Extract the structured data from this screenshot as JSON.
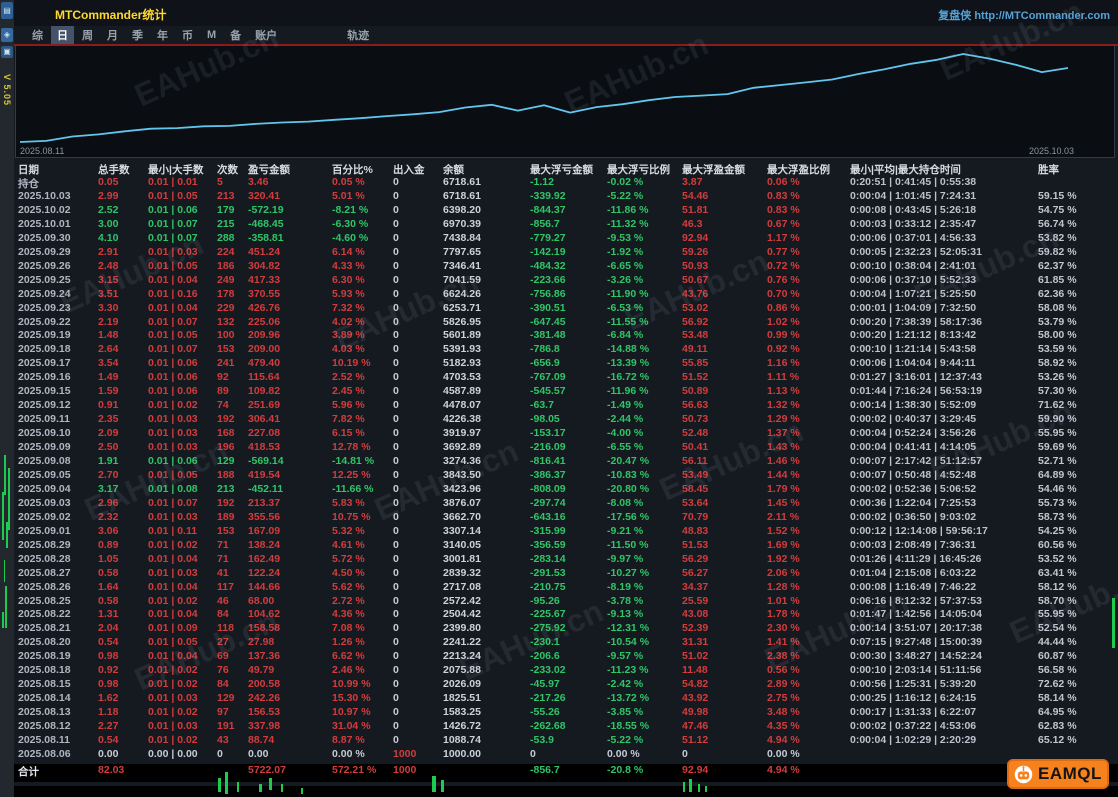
{
  "window": {
    "title": "MTCommander统计",
    "site_link": "复盘侠 http://MTCommander.com",
    "version": "V 5.05"
  },
  "tabs": {
    "items": [
      "综",
      "日",
      "周",
      "月",
      "季",
      "年",
      "币",
      "M",
      "备",
      "账户"
    ],
    "active": "日",
    "detached": "轨迹"
  },
  "watermark": "EAHub.cn",
  "logo": {
    "text": "EAMQL",
    "icon": "robot-icon"
  },
  "colors": {
    "profit_red": "#d23c3c",
    "loss_green": "#2fc566",
    "neutral": "#c6ccd5",
    "date_text": "#aeb6c2",
    "time_text": "#bac2cc",
    "curve_blue": "#62c6ec",
    "title_yellow": "#ffd92e",
    "link_blue": "#53a3d8",
    "logo_orange": "#f6821f"
  },
  "chart": {
    "start_label": "2025.08.11",
    "end_label": "2025.10.03"
  },
  "chart_data": {
    "type": "line",
    "title": "账户余额曲线",
    "xlabel": "",
    "ylabel": "余额",
    "ylim": [
      1000,
      7797.65
    ],
    "legend": "none",
    "grid": false,
    "x": [
      "2025.08.06",
      "2025.08.11",
      "2025.08.12",
      "2025.08.13",
      "2025.08.14",
      "2025.08.15",
      "2025.08.18",
      "2025.08.19",
      "2025.08.20",
      "2025.08.21",
      "2025.08.22",
      "2025.08.25",
      "2025.08.26",
      "2025.08.27",
      "2025.08.28",
      "2025.08.29",
      "2025.09.01",
      "2025.09.02",
      "2025.09.03",
      "2025.09.04",
      "2025.09.05",
      "2025.09.08",
      "2025.09.09",
      "2025.09.10",
      "2025.09.11",
      "2025.09.12",
      "2025.09.15",
      "2025.09.16",
      "2025.09.17",
      "2025.09.18",
      "2025.09.19",
      "2025.09.22",
      "2025.09.23",
      "2025.09.24",
      "2025.09.25",
      "2025.09.26",
      "2025.09.29",
      "2025.09.30",
      "2025.10.01",
      "2025.10.02",
      "2025.10.03"
    ],
    "series": [
      {
        "name": "余额",
        "values": [
          1000.0,
          1088.74,
          1426.72,
          1583.25,
          1825.51,
          2026.09,
          2075.88,
          2213.24,
          2241.22,
          2399.8,
          2504.42,
          2572.42,
          2717.08,
          2839.32,
          3001.81,
          3140.05,
          3307.14,
          3662.7,
          3876.07,
          3423.96,
          3843.5,
          3274.36,
          3692.89,
          3919.97,
          4226.38,
          4478.07,
          4587.89,
          4703.53,
          5182.93,
          5391.93,
          5601.89,
          5826.95,
          6253.71,
          6624.26,
          7041.59,
          7346.41,
          7797.65,
          7438.84,
          6970.39,
          6398.2,
          6718.61
        ]
      }
    ]
  },
  "table": {
    "headers": [
      "日期",
      "总手数",
      "最小|大手数",
      "次数",
      "盈亏金额",
      "百分比%",
      "出入金",
      "余额",
      "最大浮亏金额",
      "最大浮亏比例",
      "最大浮盈金额",
      "最大浮盈比例",
      "最小|平均|最大持仓时间",
      "胜率"
    ],
    "rows": [
      [
        "持仓",
        "0.05",
        "0.01 | 0.01",
        "5",
        "3.46",
        "0.05 %",
        "0",
        "6718.61",
        "-1.12",
        "-0.02 %",
        "3.87",
        "0.06 %",
        "0:20:51 | 0:41:45 | 0:55:38",
        ""
      ],
      [
        "2025.10.03",
        "2.99",
        "0.01 | 0.05",
        "213",
        "320.41",
        "5.01 %",
        "0",
        "6718.61",
        "-339.92",
        "-5.22 %",
        "54.46",
        "0.83 %",
        "0:00:04 | 1:01:45 | 7:24:31",
        "59.15 %"
      ],
      [
        "2025.10.02",
        "2.52",
        "0.01 | 0.06",
        "179",
        "-572.19",
        "-8.21 %",
        "0",
        "6398.20",
        "-844.37",
        "-11.86 %",
        "51.81",
        "0.83 %",
        "0:00:08 | 0:43:45 | 5:26:18",
        "54.75 %"
      ],
      [
        "2025.10.01",
        "3.00",
        "0.01 | 0.07",
        "215",
        "-468.45",
        "-6.30 %",
        "0",
        "6970.39",
        "-856.7",
        "-11.32 %",
        "46.3",
        "0.67 %",
        "0:00:03 | 0:33:12 | 2:35:47",
        "56.74 %"
      ],
      [
        "2025.09.30",
        "4.10",
        "0.01 | 0.07",
        "288",
        "-358.81",
        "-4.60 %",
        "0",
        "7438.84",
        "-779.27",
        "-9.53 %",
        "92.94",
        "1.17 %",
        "0:00:06 | 0:37:01 | 4:56:33",
        "53.82 %"
      ],
      [
        "2025.09.29",
        "2.91",
        "0.01 | 0.03",
        "224",
        "451.24",
        "6.14 %",
        "0",
        "7797.65",
        "-142.19",
        "-1.92 %",
        "59.26",
        "0.77 %",
        "0:00:05 | 2:32:23 | 52:05:31",
        "59.82 %"
      ],
      [
        "2025.09.26",
        "2.48",
        "0.01 | 0.05",
        "186",
        "304.82",
        "4.33 %",
        "0",
        "7346.41",
        "-484.32",
        "-6.65 %",
        "50.93",
        "0.72 %",
        "0:00:10 | 0:38:04 | 2:41:01",
        "62.37 %"
      ],
      [
        "2025.09.25",
        "3.15",
        "0.01 | 0.04",
        "249",
        "417.33",
        "6.30 %",
        "0",
        "7041.59",
        "-223.66",
        "-3.26 %",
        "50.67",
        "0.76 %",
        "0:00:06 | 0:37:10 | 5:52:33",
        "61.85 %"
      ],
      [
        "2025.09.24",
        "3.51",
        "0.01 | 0.16",
        "178",
        "370.55",
        "5.93 %",
        "0",
        "6624.26",
        "-756.86",
        "-11.90 %",
        "43.76",
        "0.70 %",
        "0:00:04 | 1:07:21 | 5:25:50",
        "62.36 %"
      ],
      [
        "2025.09.23",
        "3.30",
        "0.01 | 0.04",
        "229",
        "426.76",
        "7.32 %",
        "0",
        "6253.71",
        "-390.51",
        "-6.53 %",
        "53.02",
        "0.86 %",
        "0:00:01 | 1:04:09 | 7:32:50",
        "58.08 %"
      ],
      [
        "2025.09.22",
        "2.19",
        "0.01 | 0.07",
        "132",
        "225.06",
        "4.02 %",
        "0",
        "5826.95",
        "-647.45",
        "-11.55 %",
        "56.92",
        "1.02 %",
        "0:00:20 | 7:38:39 | 58:17:36",
        "53.79 %"
      ],
      [
        "2025.09.19",
        "1.48",
        "0.01 | 0.05",
        "100",
        "209.96",
        "3.89 %",
        "0",
        "5601.89",
        "-381.48",
        "-6.84 %",
        "53.48",
        "0.99 %",
        "0:00:20 | 1:21:12 | 8:13:42",
        "58.00 %"
      ],
      [
        "2025.09.18",
        "2.64",
        "0.01 | 0.07",
        "153",
        "209.00",
        "4.03 %",
        "0",
        "5391.93",
        "-786.8",
        "-14.88 %",
        "49.11",
        "0.92 %",
        "0:00:10 | 1:21:14 | 5:43:58",
        "53.59 %"
      ],
      [
        "2025.09.17",
        "3.54",
        "0.01 | 0.06",
        "241",
        "479.40",
        "10.19 %",
        "0",
        "5182.93",
        "-656.9",
        "-13.39 %",
        "55.85",
        "1.16 %",
        "0:00:06 | 1:04:04 | 9:44:11",
        "58.92 %"
      ],
      [
        "2025.09.16",
        "1.49",
        "0.01 | 0.06",
        "92",
        "115.64",
        "2.52 %",
        "0",
        "4703.53",
        "-767.09",
        "-16.72 %",
        "51.52",
        "1.11 %",
        "0:01:27 | 3:16:01 | 12:37:43",
        "53.26 %"
      ],
      [
        "2025.09.15",
        "1.59",
        "0.01 | 0.06",
        "89",
        "109.82",
        "2.45 %",
        "0",
        "4587.89",
        "-545.57",
        "-11.96 %",
        "50.89",
        "1.13 %",
        "0:01:44 | 7:16:24 | 56:53:19",
        "57.30 %"
      ],
      [
        "2025.09.12",
        "0.91",
        "0.01 | 0.02",
        "74",
        "251.69",
        "5.96 %",
        "0",
        "4478.07",
        "-63.7",
        "-1.49 %",
        "56.63",
        "1.32 %",
        "0:00:14 | 1:38:30 | 5:52:09",
        "71.62 %"
      ],
      [
        "2025.09.11",
        "2.35",
        "0.01 | 0.03",
        "192",
        "306.41",
        "7.82 %",
        "0",
        "4226.38",
        "-98.05",
        "-2.44 %",
        "50.73",
        "1.29 %",
        "0:00:02 | 0:40:37 | 3:29:45",
        "59.90 %"
      ],
      [
        "2025.09.10",
        "2.09",
        "0.01 | 0.03",
        "168",
        "227.08",
        "6.15 %",
        "0",
        "3919.97",
        "-153.17",
        "-4.00 %",
        "52.48",
        "1.37 %",
        "0:00:04 | 0:52:24 | 3:56:26",
        "55.95 %"
      ],
      [
        "2025.09.09",
        "2.50",
        "0.01 | 0.03",
        "196",
        "418.53",
        "12.78 %",
        "0",
        "3692.89",
        "-216.09",
        "-6.55 %",
        "50.41",
        "1.43 %",
        "0:00:04 | 0:41:41 | 4:14:05",
        "59.69 %"
      ],
      [
        "2025.09.08",
        "1.91",
        "0.01 | 0.06",
        "129",
        "-569.14",
        "-14.81 %",
        "0",
        "3274.36",
        "-816.41",
        "-20.47 %",
        "56.11",
        "1.46 %",
        "0:00:07 | 2:17:42 | 51:12:57",
        "52.71 %"
      ],
      [
        "2025.09.05",
        "2.70",
        "0.01 | 0.05",
        "188",
        "419.54",
        "12.25 %",
        "0",
        "3843.50",
        "-386.37",
        "-10.83 %",
        "53.49",
        "1.44 %",
        "0:00:07 | 0:50:48 | 4:52:48",
        "64.89 %"
      ],
      [
        "2025.09.04",
        "3.17",
        "0.01 | 0.08",
        "213",
        "-452.11",
        "-11.66 %",
        "0",
        "3423.96",
        "-808.09",
        "-20.80 %",
        "58.45",
        "1.79 %",
        "0:00:02 | 0:52:36 | 5:06:52",
        "54.46 %"
      ],
      [
        "2025.09.03",
        "2.96",
        "0.01 | 0.07",
        "192",
        "213.37",
        "5.83 %",
        "0",
        "3876.07",
        "-297.74",
        "-8.08 %",
        "53.64",
        "1.45 %",
        "0:00:36 | 1:22:04 | 7:25:53",
        "55.73 %"
      ],
      [
        "2025.09.02",
        "2.32",
        "0.01 | 0.03",
        "189",
        "355.56",
        "10.75 %",
        "0",
        "3662.70",
        "-643.16",
        "-17.56 %",
        "70.79",
        "2.11 %",
        "0:00:02 | 0:36:50 | 9:03:02",
        "58.73 %"
      ],
      [
        "2025.09.01",
        "3.06",
        "0.01 | 0.11",
        "153",
        "167.09",
        "5.32 %",
        "0",
        "3307.14",
        "-315.99",
        "-9.21 %",
        "48.83",
        "1.52 %",
        "0:00:12 | 12:14:08 | 59:56:17",
        "54.25 %"
      ],
      [
        "2025.08.29",
        "0.89",
        "0.01 | 0.02",
        "71",
        "138.24",
        "4.61 %",
        "0",
        "3140.05",
        "-356.59",
        "-11.50 %",
        "51.53",
        "1.69 %",
        "0:00:03 | 2:08:49 | 7:36:31",
        "60.56 %"
      ],
      [
        "2025.08.28",
        "1.05",
        "0.01 | 0.04",
        "71",
        "162.49",
        "5.72 %",
        "0",
        "3001.81",
        "-283.14",
        "-9.97 %",
        "56.29",
        "1.92 %",
        "0:01:26 | 4:11:29 | 16:45:26",
        "53.52 %"
      ],
      [
        "2025.08.27",
        "0.58",
        "0.01 | 0.03",
        "41",
        "122.24",
        "4.50 %",
        "0",
        "2839.32",
        "-291.53",
        "-10.27 %",
        "56.27",
        "2.06 %",
        "0:01:04 | 2:15:08 | 6:03:22",
        "63.41 %"
      ],
      [
        "2025.08.26",
        "1.64",
        "0.01 | 0.04",
        "117",
        "144.66",
        "5.62 %",
        "0",
        "2717.08",
        "-210.75",
        "-8.19 %",
        "34.37",
        "1.28 %",
        "0:00:08 | 1:16:49 | 7:46:22",
        "58.12 %"
      ],
      [
        "2025.08.25",
        "0.58",
        "0.01 | 0.02",
        "46",
        "68.00",
        "2.72 %",
        "0",
        "2572.42",
        "-95.26",
        "-3.78 %",
        "25.59",
        "1.01 %",
        "0:06:16 | 8:12:32 | 57:37:53",
        "58.70 %"
      ],
      [
        "2025.08.22",
        "1.31",
        "0.01 | 0.04",
        "84",
        "104.62",
        "4.36 %",
        "0",
        "2504.42",
        "-225.67",
        "-9.13 %",
        "43.08",
        "1.78 %",
        "0:01:47 | 1:42:56 | 14:05:04",
        "55.95 %"
      ],
      [
        "2025.08.21",
        "2.04",
        "0.01 | 0.09",
        "118",
        "158.58",
        "7.08 %",
        "0",
        "2399.80",
        "-275.92",
        "-12.31 %",
        "52.39",
        "2.30 %",
        "0:00:14 | 3:51:07 | 20:17:38",
        "52.54 %"
      ],
      [
        "2025.08.20",
        "0.54",
        "0.01 | 0.05",
        "27",
        "27.98",
        "1.26 %",
        "0",
        "2241.22",
        "-230.1",
        "-10.54 %",
        "31.31",
        "1.41 %",
        "0:07:15 | 9:27:48 | 15:00:39",
        "44.44 %"
      ],
      [
        "2025.08.19",
        "0.98",
        "0.01 | 0.04",
        "69",
        "137.36",
        "6.62 %",
        "0",
        "2213.24",
        "-206.6",
        "-9.57 %",
        "51.02",
        "2.38 %",
        "0:00:30 | 3:48:27 | 14:52:24",
        "60.87 %"
      ],
      [
        "2025.08.18",
        "0.92",
        "0.01 | 0.02",
        "76",
        "49.79",
        "2.46 %",
        "0",
        "2075.88",
        "-233.02",
        "-11.23 %",
        "11.48",
        "0.56 %",
        "0:00:10 | 2:03:14 | 51:11:56",
        "56.58 %"
      ],
      [
        "2025.08.15",
        "0.98",
        "0.01 | 0.02",
        "84",
        "200.58",
        "10.99 %",
        "0",
        "2026.09",
        "-45.97",
        "-2.42 %",
        "54.82",
        "2.89 %",
        "0:00:56 | 1:25:31 | 5:39:20",
        "72.62 %"
      ],
      [
        "2025.08.14",
        "1.62",
        "0.01 | 0.03",
        "129",
        "242.26",
        "15.30 %",
        "0",
        "1825.51",
        "-217.26",
        "-13.72 %",
        "43.92",
        "2.75 %",
        "0:00:25 | 1:16:12 | 6:24:15",
        "58.14 %"
      ],
      [
        "2025.08.13",
        "1.18",
        "0.01 | 0.02",
        "97",
        "156.53",
        "10.97 %",
        "0",
        "1583.25",
        "-55.26",
        "-3.85 %",
        "49.98",
        "3.48 %",
        "0:00:17 | 1:31:33 | 6:22:07",
        "64.95 %"
      ],
      [
        "2025.08.12",
        "2.27",
        "0.01 | 0.03",
        "191",
        "337.98",
        "31.04 %",
        "0",
        "1426.72",
        "-262.68",
        "-18.55 %",
        "47.46",
        "4.35 %",
        "0:00:02 | 0:37:22 | 4:53:06",
        "62.83 %"
      ],
      [
        "2025.08.11",
        "0.54",
        "0.01 | 0.02",
        "43",
        "88.74",
        "8.87 %",
        "0",
        "1088.74",
        "-53.9",
        "-5.22 %",
        "51.12",
        "4.94 %",
        "0:00:04 | 1:02:29 | 2:20:29",
        "65.12 %"
      ],
      [
        "2025.08.06",
        "0.00",
        "0.00 | 0.00",
        "0",
        "0.00",
        "0.00 %",
        "1000",
        "1000.00",
        "0",
        "0.00 %",
        "0",
        "0.00 %",
        "",
        ""
      ]
    ],
    "total_label": "合计",
    "total_row": [
      "合计",
      "82.03",
      "",
      "",
      "5722.07",
      "572.21 %",
      "1000",
      "",
      "-856.7",
      "-20.8 %",
      "92.94",
      "4.94 %",
      "",
      ""
    ]
  }
}
